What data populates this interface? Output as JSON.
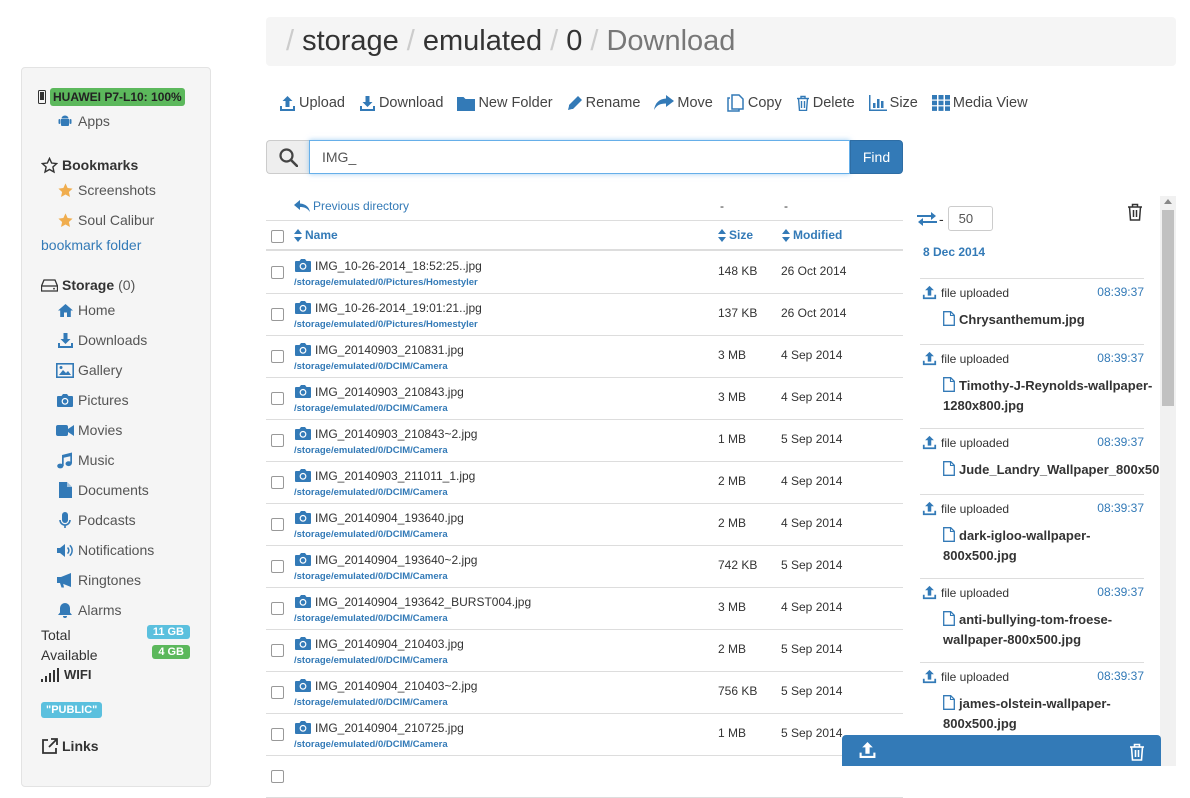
{
  "sidebar": {
    "device": {
      "label": "HUAWEI P7-L10: 100%",
      "color": "#5cb85c"
    },
    "apps_label": "Apps",
    "bookmarks_title": "Bookmarks",
    "bookmarks": [
      {
        "label": "Screenshots",
        "icon": "star-icon"
      },
      {
        "label": "Soul Calibur",
        "icon": "star-icon"
      }
    ],
    "bookmark_folder_label": "bookmark folder",
    "storage_title": "Storage",
    "storage_count": "(0)",
    "storage_items": [
      {
        "label": "Home",
        "icon": "home-icon"
      },
      {
        "label": "Downloads",
        "icon": "download-icon"
      },
      {
        "label": "Gallery",
        "icon": "picture-icon"
      },
      {
        "label": "Pictures",
        "icon": "camera-icon"
      },
      {
        "label": "Movies",
        "icon": "video-icon"
      },
      {
        "label": "Music",
        "icon": "music-icon"
      },
      {
        "label": "Documents",
        "icon": "document-icon"
      },
      {
        "label": "Podcasts",
        "icon": "microphone-icon"
      },
      {
        "label": "Notifications",
        "icon": "volume-icon"
      },
      {
        "label": "Ringtones",
        "icon": "bullhorn-icon"
      },
      {
        "label": "Alarms",
        "icon": "bell-icon"
      }
    ],
    "total_label": "Total",
    "total_value": "11 GB",
    "total_color": "#5bc0de",
    "available_label": "Available",
    "available_value": "4 GB",
    "available_color": "#5cb85c",
    "wifi_label": "WIFI",
    "public_label": "\"PUBLIC\"",
    "links_title": "Links"
  },
  "breadcrumb": {
    "parts": [
      "storage",
      "emulated",
      "0"
    ],
    "current": "Download"
  },
  "toolbar": {
    "upload": "Upload",
    "download": "Download",
    "new_folder": "New Folder",
    "rename": "Rename",
    "move": "Move",
    "copy": "Copy",
    "delete": "Delete",
    "size": "Size",
    "media_view": "Media View"
  },
  "search": {
    "value": "IMG_",
    "find_label": "Find"
  },
  "file_table": {
    "previous_directory": "Previous directory",
    "prev_size": "-",
    "prev_modified": "-",
    "columns": {
      "name": "Name",
      "size": "Size",
      "modified": "Modified"
    },
    "rows": [
      {
        "name": "IMG_10-26-2014_18:52:25..jpg",
        "path": "/storage/emulated/0/Pictures/Homestyler",
        "size": "148 KB",
        "modified": "26 Oct 2014"
      },
      {
        "name": "IMG_10-26-2014_19:01:21..jpg",
        "path": "/storage/emulated/0/Pictures/Homestyler",
        "size": "137 KB",
        "modified": "26 Oct 2014"
      },
      {
        "name": "IMG_20140903_210831.jpg",
        "path": "/storage/emulated/0/DCIM/Camera",
        "size": "3 MB",
        "modified": "4 Sep 2014"
      },
      {
        "name": "IMG_20140903_210843.jpg",
        "path": "/storage/emulated/0/DCIM/Camera",
        "size": "3 MB",
        "modified": "4 Sep 2014"
      },
      {
        "name": "IMG_20140903_210843~2.jpg",
        "path": "/storage/emulated/0/DCIM/Camera",
        "size": "1 MB",
        "modified": "5 Sep 2014"
      },
      {
        "name": "IMG_20140903_211011_1.jpg",
        "path": "/storage/emulated/0/DCIM/Camera",
        "size": "2 MB",
        "modified": "4 Sep 2014"
      },
      {
        "name": "IMG_20140904_193640.jpg",
        "path": "/storage/emulated/0/DCIM/Camera",
        "size": "2 MB",
        "modified": "4 Sep 2014"
      },
      {
        "name": "IMG_20140904_193640~2.jpg",
        "path": "/storage/emulated/0/DCIM/Camera",
        "size": "742 KB",
        "modified": "5 Sep 2014"
      },
      {
        "name": "IMG_20140904_193642_BURST004.jpg",
        "path": "/storage/emulated/0/DCIM/Camera",
        "size": "3 MB",
        "modified": "4 Sep 2014"
      },
      {
        "name": "IMG_20140904_210403.jpg",
        "path": "/storage/emulated/0/DCIM/Camera",
        "size": "2 MB",
        "modified": "5 Sep 2014"
      },
      {
        "name": "IMG_20140904_210403~2.jpg",
        "path": "/storage/emulated/0/DCIM/Camera",
        "size": "756 KB",
        "modified": "5 Sep 2014"
      },
      {
        "name": "IMG_20140904_210725.jpg",
        "path": "/storage/emulated/0/DCIM/Camera",
        "size": "1 MB",
        "modified": "5 Sep 2014"
      }
    ]
  },
  "activity": {
    "sep": "-",
    "limit": "50",
    "date": "8 Dec 2014",
    "items": [
      {
        "type": "file uploaded",
        "time": "08:39:37",
        "file": "Chrysanthemum.jpg"
      },
      {
        "type": "file uploaded",
        "time": "08:39:37",
        "file": "Timothy-J-Reynolds-wallpaper-1280x800.jpg"
      },
      {
        "type": "file uploaded",
        "time": "08:39:37",
        "file": "Jude_Landry_Wallpaper_800x50"
      },
      {
        "type": "file uploaded",
        "time": "08:39:37",
        "file": "dark-igloo-wallpaper-800x500.jpg"
      },
      {
        "type": "file uploaded",
        "time": "08:39:37",
        "file": "anti-bullying-tom-froese-wallpaper-800x500.jpg"
      },
      {
        "type": "file uploaded",
        "time": "08:39:37",
        "file": "james-olstein-wallpaper-800x500.jpg"
      }
    ]
  },
  "colors": {
    "accent": "#337ab7",
    "success": "#5cb85c",
    "info": "#5bc0de",
    "star": "#f0ad4e"
  }
}
